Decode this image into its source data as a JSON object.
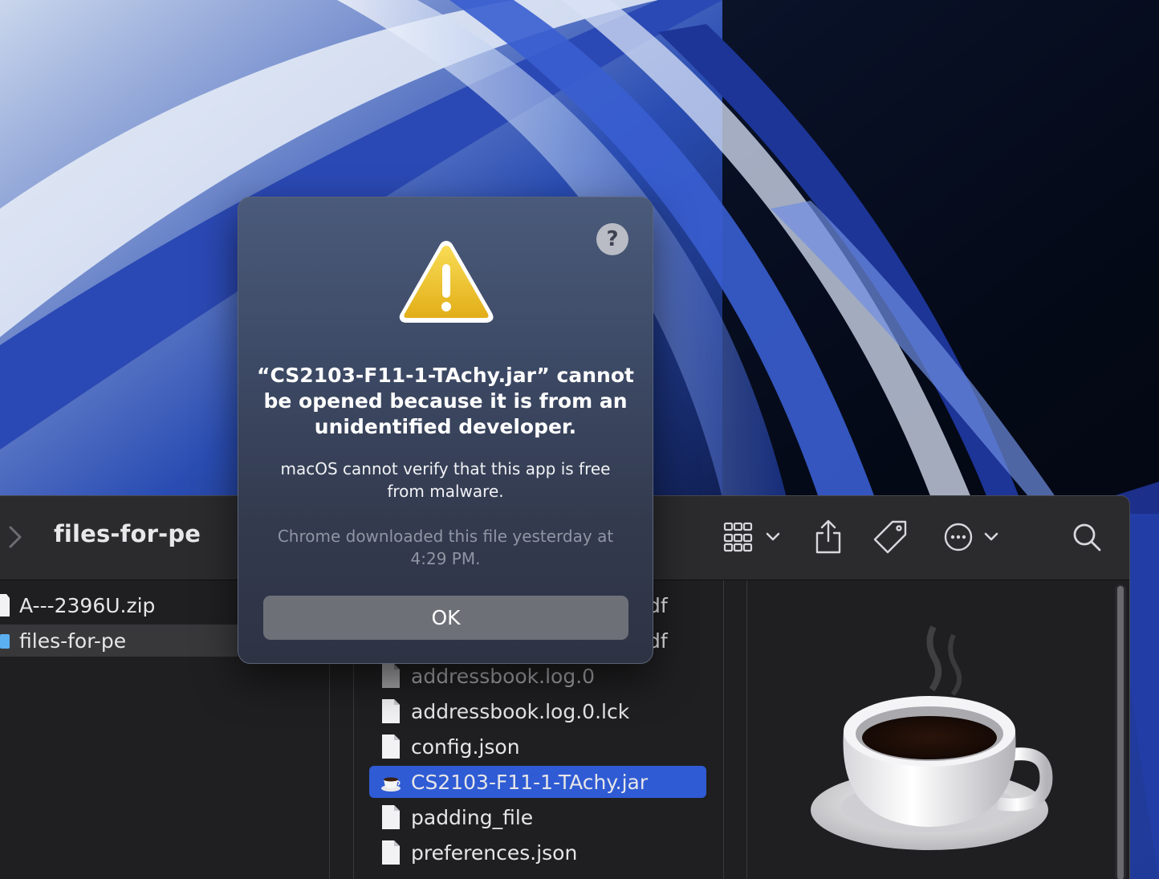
{
  "dialog": {
    "title": "“CS2103-F11-1-TAchy.jar” cannot be opened because it is from an unidentified developer.",
    "message": "macOS cannot verify that this app is free from malware.",
    "note": "Chrome downloaded this file yesterday at 4:29 PM.",
    "ok_label": "OK",
    "help_label": "?"
  },
  "finder": {
    "title": "files-for-pe",
    "column1": [
      {
        "name": "A---2396U.zip",
        "kind": "file"
      },
      {
        "name": "files-for-pe",
        "kind": "folder",
        "selected": true
      }
    ],
    "column2": [
      {
        "name": "addressbook.log.0",
        "kind": "file"
      },
      {
        "name": "addressbook.log.0.lck",
        "kind": "file"
      },
      {
        "name": "config.json",
        "kind": "file"
      },
      {
        "name": "CS2103-F11-1-TAchy.jar",
        "kind": "jar",
        "selected": true
      },
      {
        "name": "padding_file",
        "kind": "file"
      },
      {
        "name": "preferences.json",
        "kind": "file"
      }
    ],
    "column2_partial": [
      "df",
      "df"
    ]
  },
  "toolbar": {
    "icons": [
      "chevron-right-icon",
      "grid-view-icon",
      "share-icon",
      "tag-icon",
      "more-icon",
      "search-icon"
    ]
  }
}
